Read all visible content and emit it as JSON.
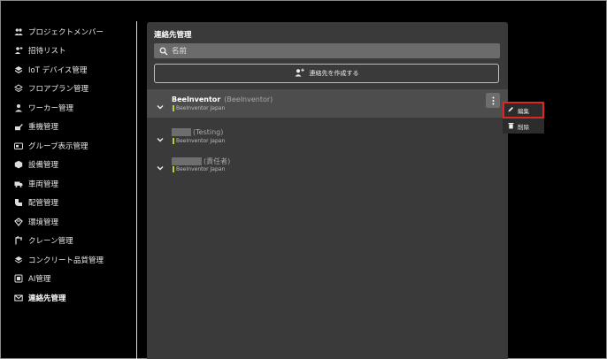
{
  "sidebar": {
    "items": [
      {
        "label": "プロジェクトメンバー",
        "icon": "people-icon"
      },
      {
        "label": "招待リスト",
        "icon": "person-add-icon"
      },
      {
        "label": "IoT デバイス管理",
        "icon": "cube-icon"
      },
      {
        "label": "フロアプラン管理",
        "icon": "layers-icon"
      },
      {
        "label": "ワーカー管理",
        "icon": "person-icon"
      },
      {
        "label": "重機管理",
        "icon": "excavator-icon"
      },
      {
        "label": "グループ表示管理",
        "icon": "card-icon"
      },
      {
        "label": "設備管理",
        "icon": "box-icon"
      },
      {
        "label": "車両管理",
        "icon": "truck-icon"
      },
      {
        "label": "配管管理",
        "icon": "pipe-icon"
      },
      {
        "label": "環境管理",
        "icon": "environment-icon"
      },
      {
        "label": "クレーン管理",
        "icon": "crane-icon"
      },
      {
        "label": "コンクリート品質管理",
        "icon": "concrete-icon"
      },
      {
        "label": "AI管理",
        "icon": "ai-icon"
      },
      {
        "label": "連絡先管理",
        "icon": "mail-icon",
        "active": true
      }
    ]
  },
  "main": {
    "title": "連絡先管理",
    "search_placeholder": "名前",
    "create_label": "連絡先を作成する",
    "contacts": [
      {
        "name": "BeeInventor",
        "sub": "(BeeInventor)",
        "tag": "BeeInventor Japan"
      },
      {
        "name": "",
        "sub": "(Testing)",
        "tag": "BeeInventor Japan"
      },
      {
        "name": "",
        "sub": "(責任者)",
        "tag": "BeeInventor Japan"
      }
    ]
  },
  "menu": {
    "edit_label": "編集",
    "delete_label": "削除"
  },
  "colors": {
    "panel": "#3a3a3a",
    "highlight_row": "#4d4d4d",
    "tag_accent": "#b5d334",
    "focus_outline": "#e02424"
  }
}
